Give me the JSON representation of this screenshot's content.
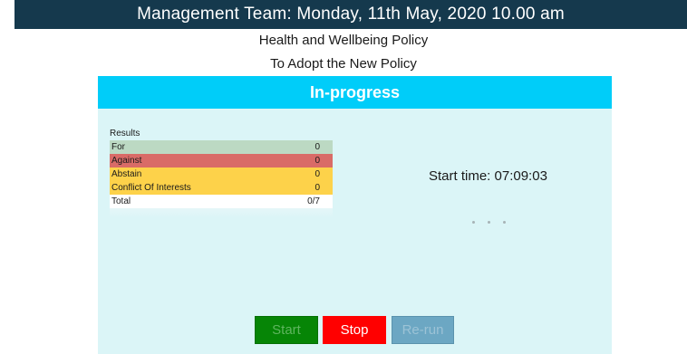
{
  "header": {
    "title": "Management Team: Monday, 11th May, 2020 10.00 am"
  },
  "item": {
    "title": "Health and Wellbeing Policy"
  },
  "motion": {
    "title": "To Adopt the New Policy"
  },
  "status": {
    "label": "In-progress"
  },
  "results": {
    "label": "Results",
    "rows": [
      {
        "label": "For",
        "value": "0"
      },
      {
        "label": "Against",
        "value": "0"
      },
      {
        "label": "Abstain",
        "value": "0"
      },
      {
        "label": "Conflict Of Interests",
        "value": "0"
      },
      {
        "label": "Total",
        "value": "0/7"
      }
    ]
  },
  "timer": {
    "start_time": "Start time: 07:09:03"
  },
  "buttons": {
    "start": "Start",
    "stop": "Stop",
    "rerun": "Re-run"
  },
  "colors": {
    "header_bg": "#15394d",
    "status_bg": "#00cdf9",
    "panel_bg": "#dbf5f7",
    "for": "#bcd9c3",
    "against": "#d96b67",
    "abstain": "#fdd24a",
    "start_button": "#068506",
    "stop_button": "#ff0000",
    "rerun_button": "#6ca7c3"
  }
}
